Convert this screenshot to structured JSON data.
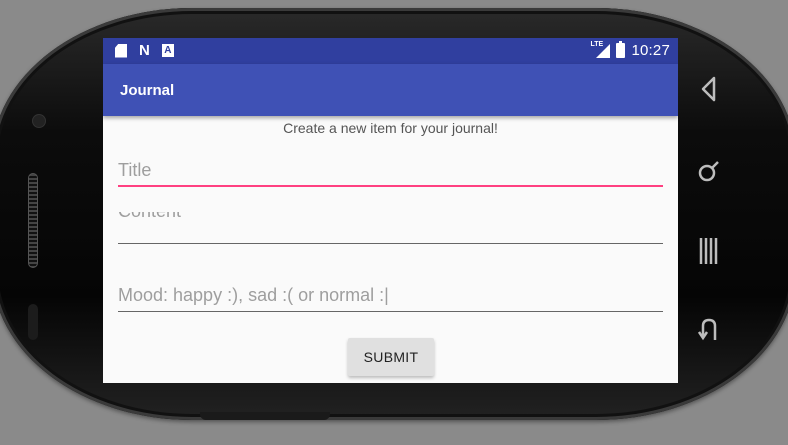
{
  "status_bar": {
    "time": "10:27",
    "network": "LTE",
    "notification_icons": [
      "sd-card-icon",
      "n-notification-icon",
      "a-notification-icon"
    ],
    "a_icon_letter": "A",
    "n_icon_letter": "N"
  },
  "app_bar": {
    "title": "Journal"
  },
  "form": {
    "subtitle": "Create a new item for your journal!",
    "title_placeholder": "Title",
    "content_placeholder": "Content",
    "mood_placeholder": "Mood: happy :), sad :( or normal :|",
    "submit_label": "SUBMIT"
  },
  "device_nav": {
    "back_icon": "back-icon",
    "home_icon": "home-icon",
    "recents_icon": "recents-icon",
    "menu_icon": "menu-icon"
  },
  "colors": {
    "status_bar": "#303f9f",
    "app_bar": "#3f51b5",
    "accent": "#ff4081"
  }
}
